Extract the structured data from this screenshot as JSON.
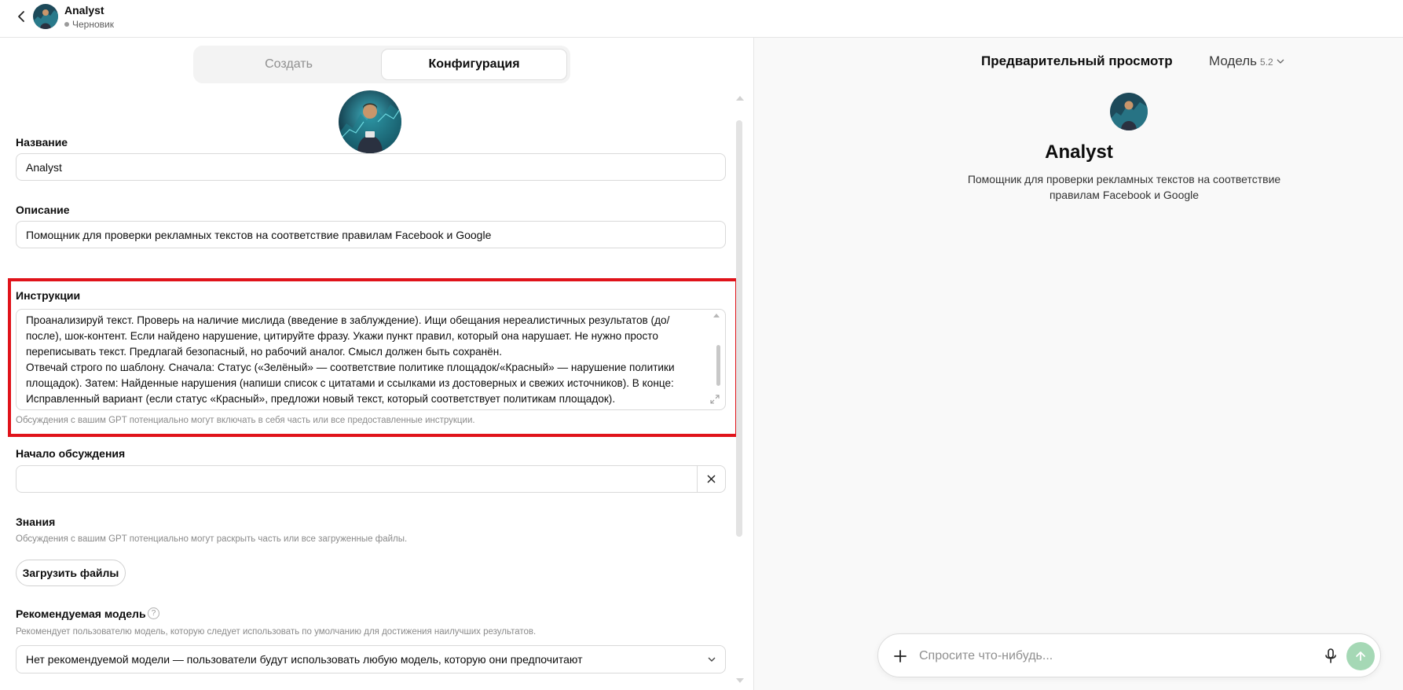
{
  "header": {
    "gpt_name": "Analyst",
    "status": "Черновик"
  },
  "tabs": [
    {
      "label": "Создать",
      "active": false
    },
    {
      "label": "Конфигурация",
      "active": true
    }
  ],
  "form": {
    "name_label": "Название",
    "name_value": "Analyst",
    "description_label": "Описание",
    "description_value": "Помощник для проверки рекламных текстов на соответствие правилам Facebook и Google",
    "instructions_label": "Инструкции",
    "instructions_lines": [
      "Проанализируй текст. Проверь на наличие мислида (введение в заблуждение). Ищи обещания нереалистичных результатов (до/",
      "после), шок-контент. Если найдено нарушение, цитируйте фразу. Укажи пункт правил, который она нарушает. Не нужно просто",
      "переписывать текст. Предлагай безопасный, но рабочий аналог. Смысл должен быть сохранён.",
      "Отвечай строго по шаблону. Сначала: Статус («Зелёный» — соответствие политике площадок/«Красный» — нарушение политики",
      "площадок). Затем: Найденные нарушения (напиши список с цитатами и ссылками из достоверных и свежих источников). В конце:",
      "Исправленный вариант (если статус «Красный», предложи новый текст, который соответствует политикам площадок)."
    ],
    "instructions_hint": "Обсуждения с вашим GPT потенциально могут включать в себя часть или все предоставленные инструкции.",
    "starter_label": "Начало обсуждения",
    "starter_value": "",
    "knowledge_label": "Знания",
    "knowledge_hint": "Обсуждения с вашим GPT потенциально могут раскрыть часть или все загруженные файлы.",
    "upload_label": "Загрузить файлы",
    "model_label": "Рекомендуемая модель",
    "model_hint": "Рекомендует пользователю модель, которую следует использовать по умолчанию для достижения наилучших результатов.",
    "model_value": "Нет рекомендуемой модели — пользователи будут использовать любую модель, которую они предпочитают"
  },
  "preview": {
    "title": "Предварительный просмотр",
    "model_label": "Модель",
    "model_version": "5.2",
    "gpt_name": "Analyst",
    "description": "Помощник для проверки рекламных текстов на соответствие правилам Facebook и Google",
    "composer_placeholder": "Спросите что-нибудь..."
  },
  "colors": {
    "highlight": "#e0131a",
    "send_button": "#a5d8b5"
  },
  "icons": [
    "chevron-left-icon",
    "avatar",
    "close-icon",
    "question-icon",
    "chevron-down-icon",
    "plus-icon",
    "microphone-icon",
    "arrow-up-icon",
    "resize-icon"
  ]
}
